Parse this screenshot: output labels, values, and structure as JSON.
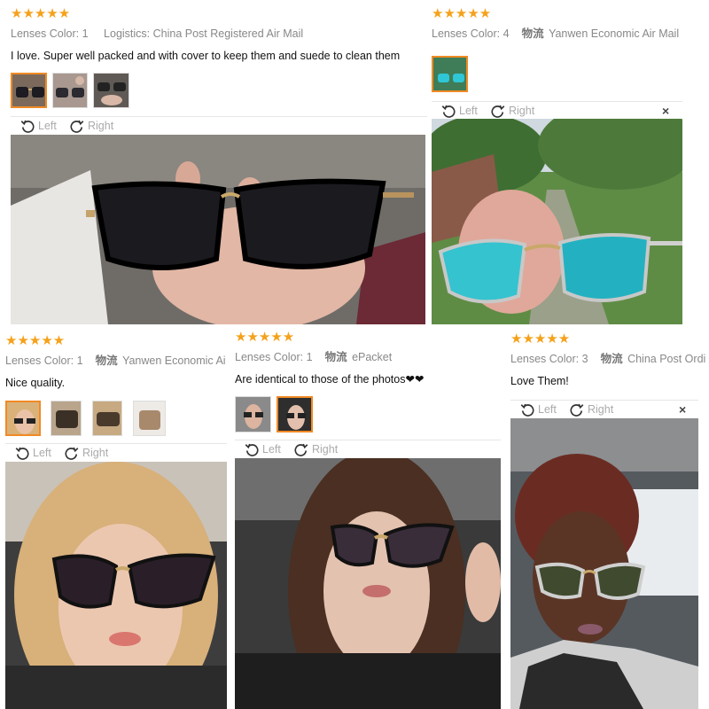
{
  "colors": {
    "star": "#f5a11b",
    "selected_border": "#f08a24"
  },
  "toolbar": {
    "left_label": "Left",
    "right_label": "Right",
    "close_glyph": "×"
  },
  "reviews": [
    {
      "stars": "★★★★★",
      "color": "Lenses Color: 1",
      "logistics": "Logistics: China Post Registered Air Mail",
      "logistics_zh": "",
      "text": "I love. Super well packed and with cover to keep them and suede to clean them"
    },
    {
      "stars": "★★★★★",
      "color": "Lenses Color: 4",
      "logistics_zh": "物流",
      "logistics": "Yanwen Economic Air Mail",
      "text": ""
    },
    {
      "stars": "★★★★★",
      "color": "Lenses Color: 1",
      "logistics_zh": "物流",
      "logistics": "Yanwen Economic Ai",
      "text": "Nice quality."
    },
    {
      "stars": "★★★★★",
      "color": "Lenses Color: 1",
      "logistics_zh": "物流",
      "logistics": "ePacket",
      "text": "Are identical to those of the photos❤❤"
    },
    {
      "stars": "★★★★★",
      "color": "Lenses Color: 3",
      "logistics_zh": "物流",
      "logistics": "China Post Ordi",
      "text": "Love Them!"
    }
  ]
}
